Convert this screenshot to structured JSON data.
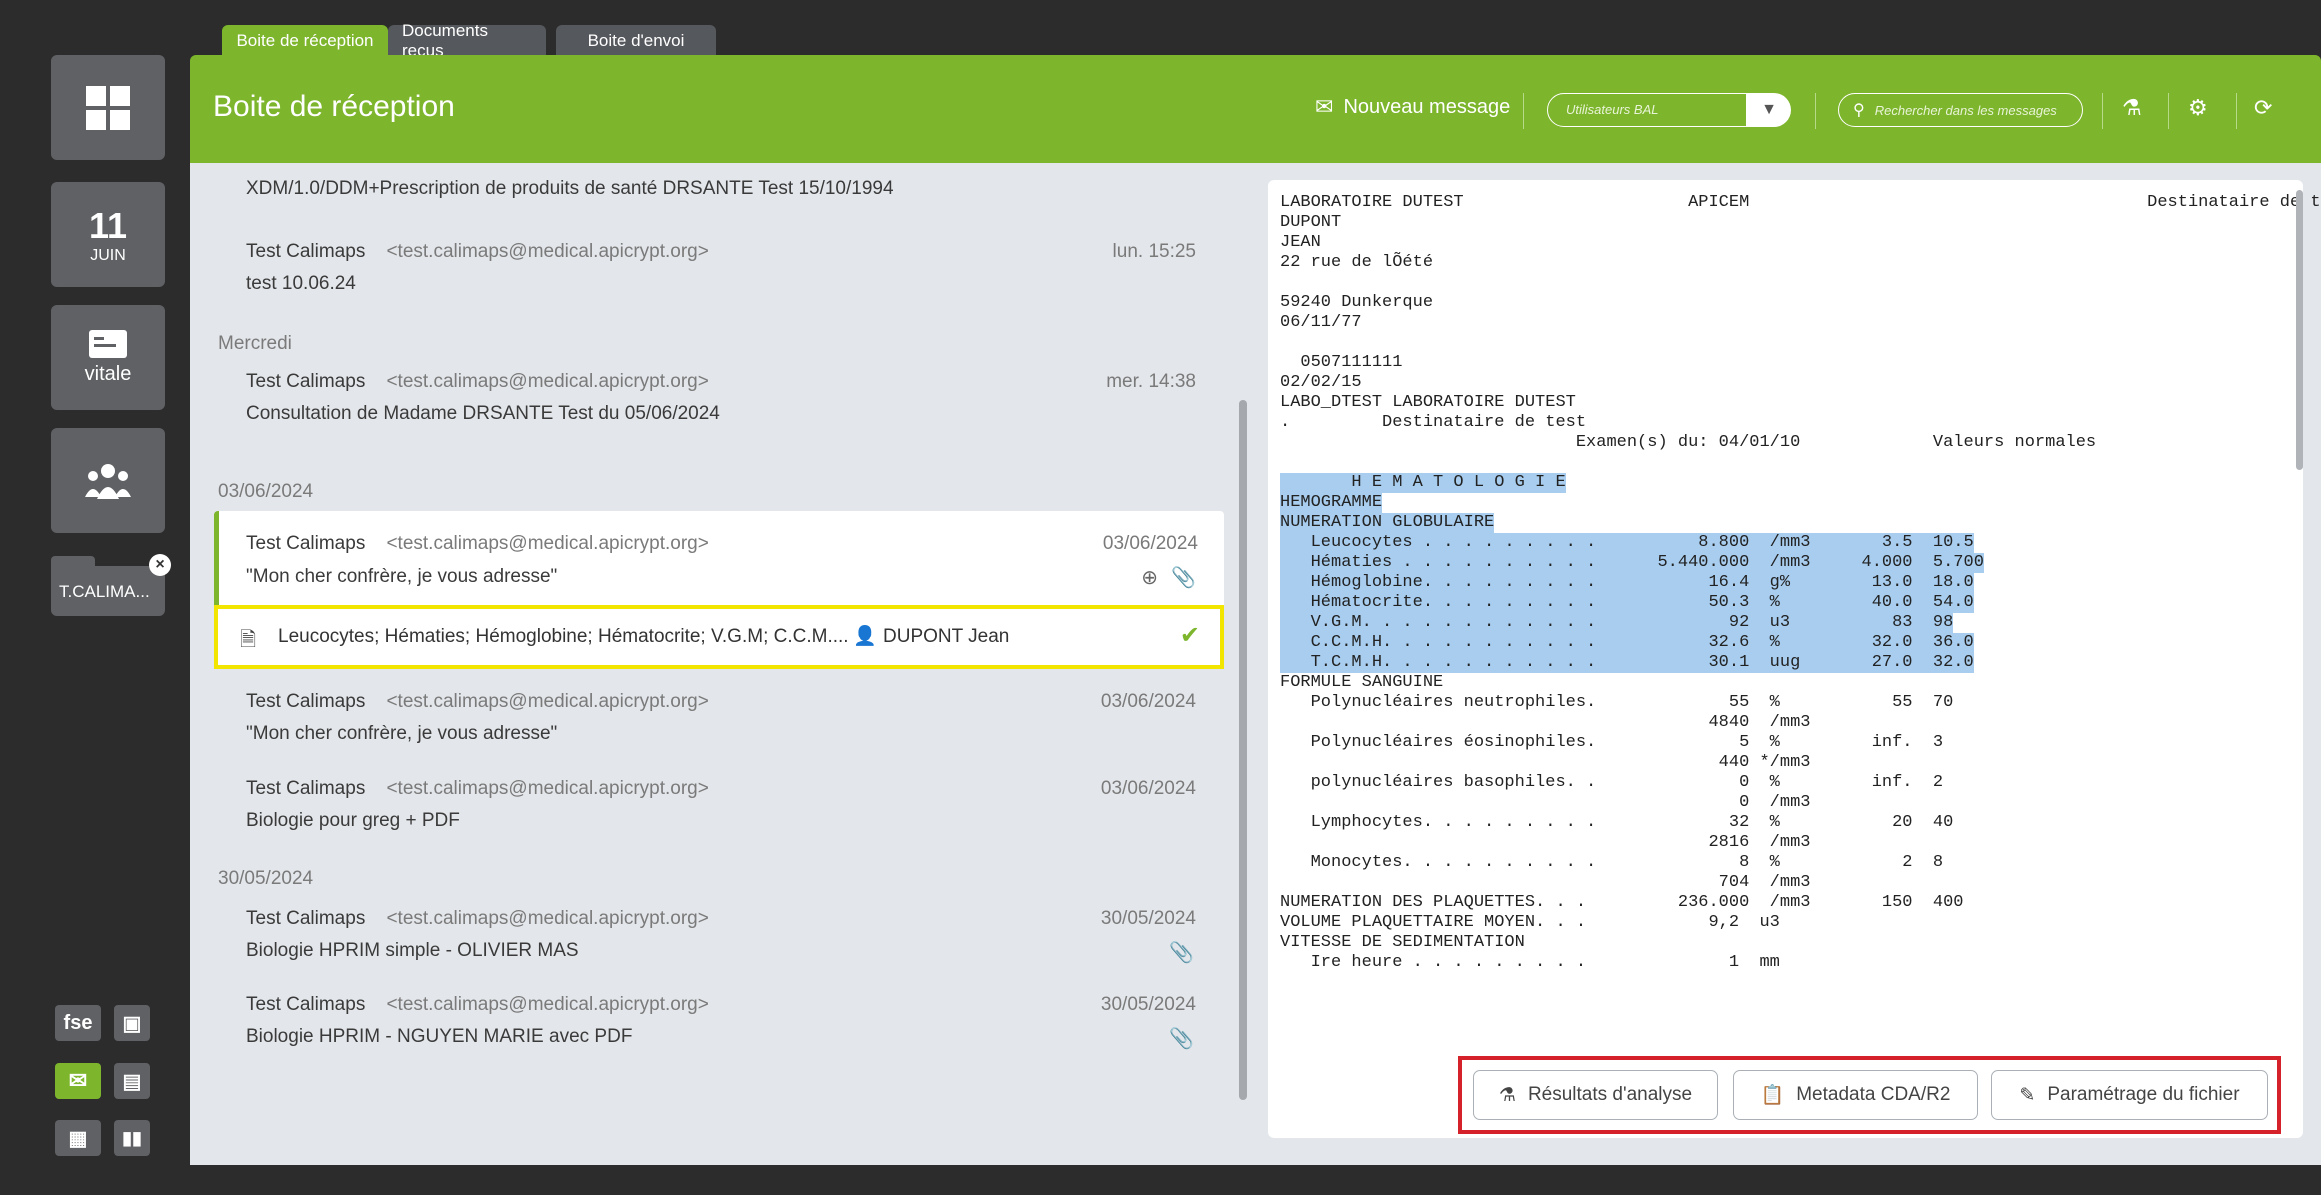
{
  "tabs": [
    "Boite de réception",
    "Documents reçus",
    "Boite d'envoi"
  ],
  "header": {
    "title": "Boite de réception",
    "new_message": "Nouveau message",
    "user_select_placeholder": "Utilisateurs BAL",
    "search_placeholder": "Rechercher dans les messages"
  },
  "dock": {
    "day": "11",
    "month": "JUIN",
    "vitale": "vitale",
    "user_label": "T.CALIMA...",
    "fse": "fse"
  },
  "list": {
    "top_subject": "XDM/1.0/DDM+Prescription de produits de santé DRSANTE Test 15/10/1994",
    "groups": [
      "Mercredi",
      "03/06/2024",
      "30/05/2024"
    ],
    "messages": [
      {
        "sender": "Test Calimaps",
        "email": "<test.calimaps@medical.apicrypt.org>",
        "subject": "test 10.06.24",
        "date": "lun. 15:25"
      },
      {
        "sender": "Test Calimaps",
        "email": "<test.calimaps@medical.apicrypt.org>",
        "subject": "Consultation de Madame DRSANTE Test du 05/06/2024",
        "date": "mer. 14:38"
      },
      {
        "sender": "Test Calimaps",
        "email": "<test.calimaps@medical.apicrypt.org>",
        "subject": "\"Mon cher confrère, je vous adresse\"",
        "date": "03/06/2024"
      },
      {
        "sender": "Test Calimaps",
        "email": "<test.calimaps@medical.apicrypt.org>",
        "subject": "\"Mon cher confrère, je vous adresse\"",
        "date": "03/06/2024"
      },
      {
        "sender": "Test Calimaps",
        "email": "<test.calimaps@medical.apicrypt.org>",
        "subject": "Biologie pour greg + PDF",
        "date": "03/06/2024"
      },
      {
        "sender": "Test Calimaps",
        "email": "<test.calimaps@medical.apicrypt.org>",
        "subject": "Biologie HPRIM simple - OLIVIER MAS",
        "date": "30/05/2024"
      },
      {
        "sender": "Test Calimaps",
        "email": "<test.calimaps@medical.apicrypt.org>",
        "subject": "Biologie HPRIM - NGUYEN MARIE avec PDF",
        "date": "30/05/2024"
      }
    ],
    "attachment": {
      "text": "Leucocytes; Hématies; Hémoglobine; Hématocrite; V.G.M; C.C.M....",
      "patient": "DUPONT Jean"
    }
  },
  "preview": {
    "lines": [
      "LABORATOIRE DUTEST                      APICEM                                       Destinataire de test",
      "DUPONT",
      "JEAN",
      "22 rue de lÕété",
      "",
      "59240 Dunkerque",
      "06/11/77",
      "",
      "  0507111111",
      "02/02/15",
      "LABO_DTEST LABORATOIRE DUTEST",
      ".         Destinataire de test",
      "                             Examen(s) du: 04/01/10             Valeurs normales",
      "",
      "       H E M A T O L O G I E",
      "HEMOGRAMME",
      "NUMERATION GLOBULAIRE",
      "   Leucocytes . . . . . . . . .          8.800  /mm3       3.5  10.5",
      "   Hématies . . . . . . . . . .      5.440.000  /mm3     4.000  5.700",
      "   Hémoglobine. . . . . . . . .           16.4  g%        13.0  18.0",
      "   Hématocrite. . . . . . . . .           50.3  %         40.0  54.0",
      "   V.G.M. . . . . . . . . . . .             92  u3          83  98",
      "   C.C.M.H. . . . . . . . . . .           32.6  %         32.0  36.0",
      "   T.C.M.H. . . . . . . . . . .           30.1  uug       27.0  32.0",
      "FORMULE SANGUINE",
      "   Polynucléaires neutrophiles.             55  %           55  70",
      "                                          4840  /mm3",
      "   Polynucléaires éosinophiles.              5  %         inf.  3",
      "                                           440 */mm3",
      "   polynucléaires basophiles. .              0  %         inf.  2",
      "                                             0  /mm3",
      "   Lymphocytes. . . . . . . . .             32  %           20  40",
      "                                          2816  /mm3",
      "   Monocytes. . . . . . . . . .              8  %            2  8",
      "                                           704  /mm3",
      "NUMERATION DES PLAQUETTES. . .         236.000  /mm3       150  400",
      "VOLUME PLAQUETTAIRE MOYEN. . .            9,2  u3",
      "VITESSE DE SEDIMENTATION",
      "   Ire heure . . . . . . . . .              1  mm"
    ],
    "buttons": [
      "Résultats d'analyse",
      "Metadata CDA/R2",
      "Paramétrage du fichier"
    ]
  },
  "colors": {
    "accent": "#7db52d",
    "selection": "#a8cdef",
    "highlight_yellow": "#f2e600",
    "highlight_red": "#d4212a"
  }
}
